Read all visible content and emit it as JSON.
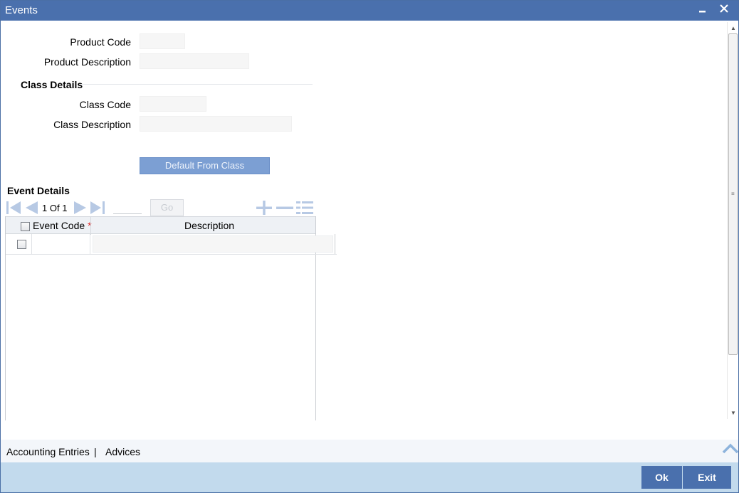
{
  "window": {
    "title": "Events",
    "minimize_icon": "minimize-icon",
    "close_icon": "close-icon"
  },
  "product": {
    "code_label": "Product Code",
    "code_value": "",
    "description_label": "Product Description",
    "description_value": ""
  },
  "class_details": {
    "section_title": "Class Details",
    "code_label": "Class Code",
    "code_value": "",
    "description_label": "Class Description",
    "description_value": ""
  },
  "default_from_class_label": "Default From Class",
  "event_details": {
    "section_title": "Event Details",
    "pagination": {
      "current": "1",
      "of_label": "Of",
      "total": "1",
      "go_label": "Go",
      "page_input_value": ""
    },
    "columns": [
      {
        "label": "Event Code",
        "required": true
      },
      {
        "label": "Description",
        "required": false
      }
    ],
    "rows": [
      {
        "event_code": "",
        "description": ""
      }
    ]
  },
  "footer": {
    "links": [
      "Accounting Entries",
      "Advices"
    ],
    "separator": "|"
  },
  "actions": {
    "ok_label": "Ok",
    "exit_label": "Exit"
  },
  "colors": {
    "titlebar": "#4a70ad",
    "button_primary": "#4a70ad",
    "bottom_bar": "#c2daed",
    "icon_disabled": "#b7c9e4"
  }
}
